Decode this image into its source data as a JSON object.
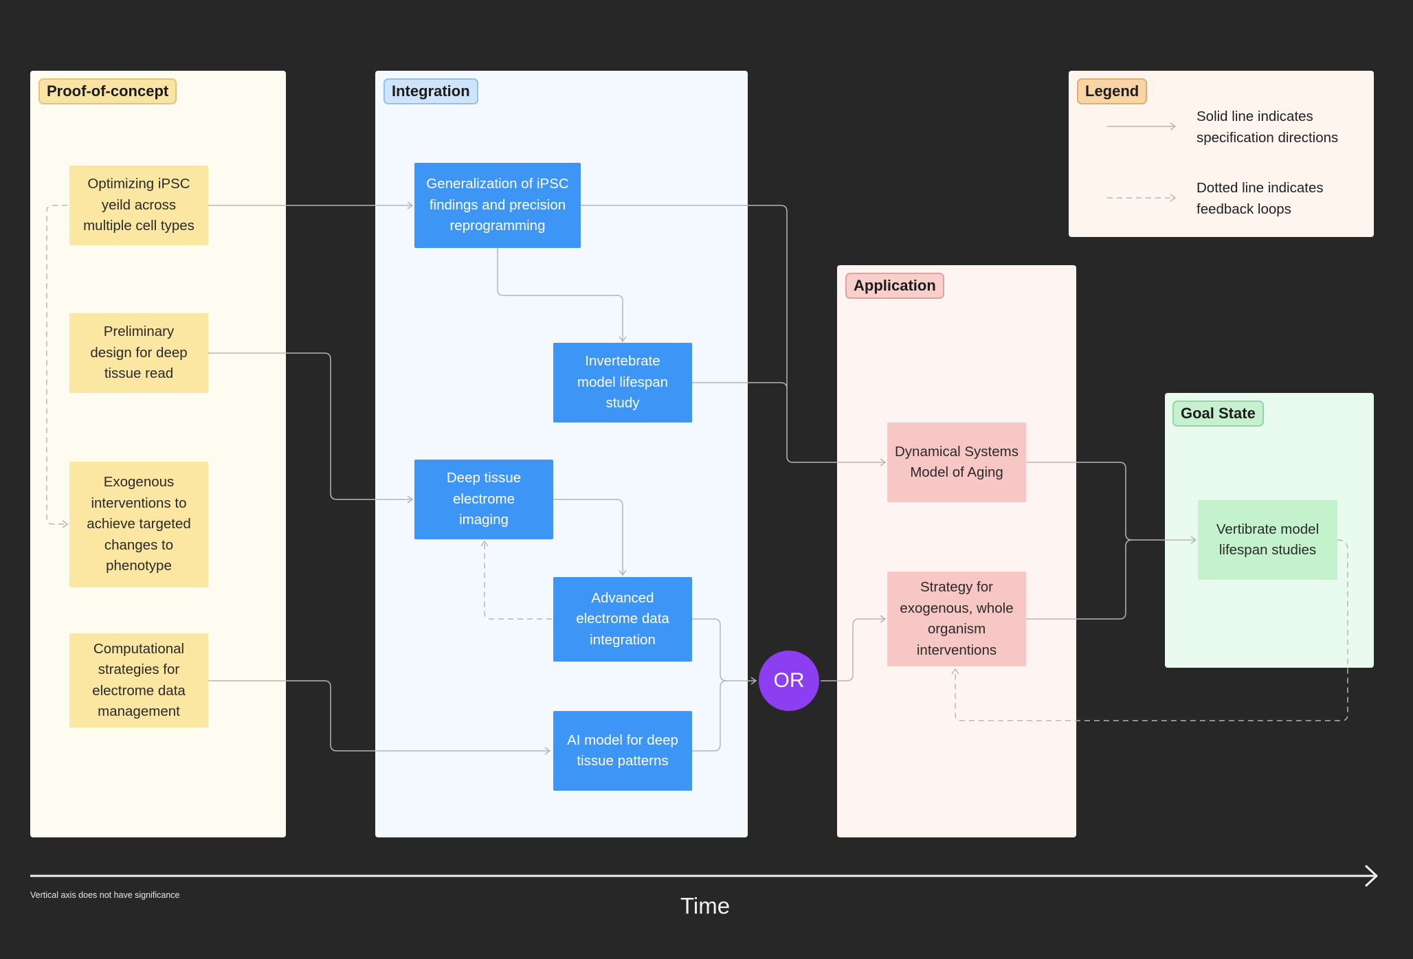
{
  "columns": {
    "proof": "Proof-of-concept",
    "integration": "Integration",
    "application": "Application",
    "goal": "Goal State",
    "legend": "Legend"
  },
  "nodes": {
    "ipsc_yield": [
      "Optimizing iPSC",
      "yeild across",
      "multiple cell types"
    ],
    "deep_tissue_design": [
      "Preliminary",
      "design for deep",
      "tissue read"
    ],
    "exogenous": [
      "Exogenous",
      "interventions to",
      "achieve targeted",
      "changes to",
      "phenotype"
    ],
    "computational": [
      "Computational",
      "strategies for",
      "electrome data",
      "management"
    ],
    "generalization": [
      "Generalization of iPSC",
      "findings and precision",
      "reprogramming"
    ],
    "invertebrate": [
      "Invertebrate",
      "model lifespan",
      "study"
    ],
    "deep_imaging": [
      "Deep tissue",
      "electrome",
      "imaging"
    ],
    "advanced_integration": [
      "Advanced",
      "electrome data",
      "integration"
    ],
    "ai_model": [
      "AI model for deep",
      "tissue patterns"
    ],
    "dynamical": [
      "Dynamical Systems",
      "Model of Aging"
    ],
    "strategy": [
      "Strategy for",
      "exogenous, whole",
      "organism",
      "interventions"
    ],
    "vertibrate": [
      "Vertibrate model",
      "lifespan studies"
    ],
    "or": "OR"
  },
  "legend": {
    "solid": [
      "Solid line indicates",
      "specification directions"
    ],
    "dotted": [
      "Dotted line indicates",
      "feedback loops"
    ]
  },
  "axis": {
    "title": "Time",
    "note": "Vertical axis does not have significance"
  },
  "colors": {
    "background": "#272727",
    "proof_panel": "#fefcf0",
    "integration_panel": "#f3f9fe",
    "application_panel": "#fef5f3",
    "goal_panel": "#e9faee",
    "legend_panel": "#fef6ee",
    "yellow_node": "#fbe7a1",
    "blue_node": "#3d95f5",
    "pink_node": "#f7c7c5",
    "green_node": "#c3f2cd",
    "or_node": "#8b3ff0"
  }
}
